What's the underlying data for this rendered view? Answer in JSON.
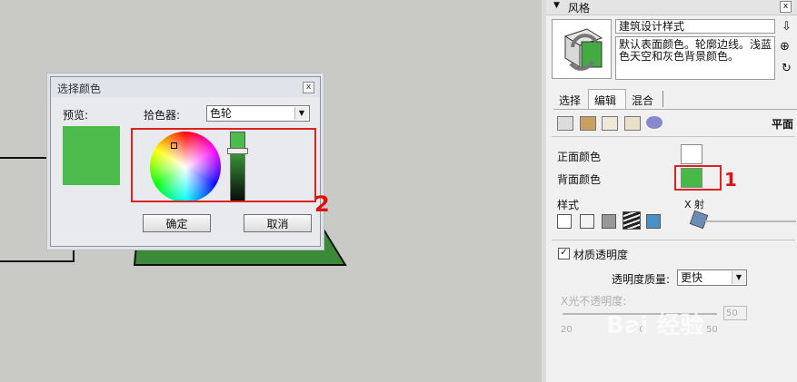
{
  "dialog": {
    "title": "选择颜色",
    "close_glyph": "x",
    "preview_label": "预览:",
    "picker_label": "拾色器:",
    "picker_value": "色轮",
    "ok_label": "确定",
    "cancel_label": "取消"
  },
  "annotations": {
    "one": "1",
    "two": "2"
  },
  "panel": {
    "title": "风格",
    "close_glyph": "x",
    "style_name": "建筑设计样式",
    "style_desc": "默认表面颜色。轮廓边线。浅蓝色天空和灰色背景颜色。",
    "tabs": [
      {
        "label": "选择"
      },
      {
        "label": "编辑"
      },
      {
        "label": "混合"
      }
    ],
    "section_face": "平面",
    "front_color_label": "正面颜色",
    "back_color_label": "背面颜色",
    "style_label": "样式",
    "xray_label": "X 射",
    "transparency_label": "材质透明度",
    "quality_label": "透明度质量:",
    "quality_value": "更快",
    "opacity_label": "X光不透明度:",
    "opacity_value": "50",
    "tick_left": "20",
    "tick_mid": "50",
    "tick_right": "50"
  },
  "watermark": "Bai 经验",
  "colors": {
    "preview_green": "#4cbb4c",
    "back_face": "#47b947",
    "front_face": "#ffffff",
    "model_green": "#3a8a3a",
    "annotation_red": "#d22222"
  }
}
